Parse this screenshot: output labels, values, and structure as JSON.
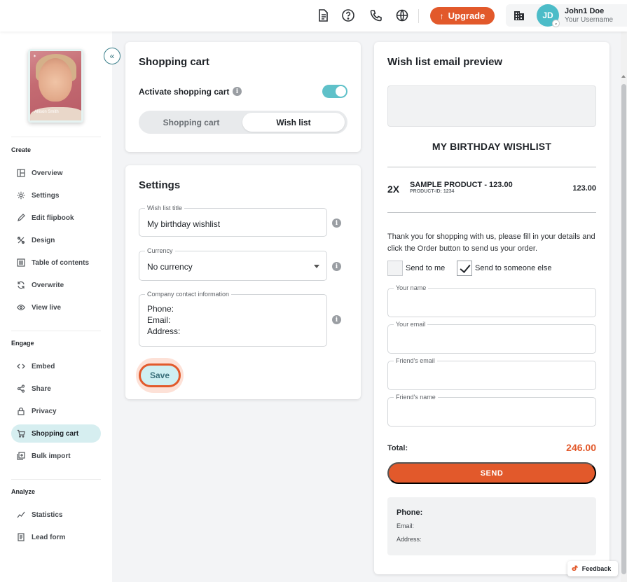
{
  "header": {
    "upgrade_label": "Upgrade",
    "user_name": "John1 Doe",
    "user_sub": "Your Username",
    "avatar_initials": "JD",
    "accent_color": "#e2592b"
  },
  "sidebar": {
    "thumb_text": "Allison Smith",
    "sections": {
      "create": "Create",
      "engage": "Engage",
      "analyze": "Analyze"
    },
    "create_items": [
      {
        "label": "Overview",
        "icon": "layout-icon"
      },
      {
        "label": "Settings",
        "icon": "gear-icon"
      },
      {
        "label": "Edit flipbook",
        "icon": "pencil-icon"
      },
      {
        "label": "Design",
        "icon": "design-tools-icon"
      },
      {
        "label": "Table of contents",
        "icon": "list-icon"
      },
      {
        "label": "Overwrite",
        "icon": "refresh-icon"
      },
      {
        "label": "View live",
        "icon": "eye-icon"
      }
    ],
    "engage_items": [
      {
        "label": "Embed",
        "icon": "code-icon"
      },
      {
        "label": "Share",
        "icon": "share-icon"
      },
      {
        "label": "Privacy",
        "icon": "lock-icon"
      },
      {
        "label": "Shopping cart",
        "icon": "cart-icon",
        "active": true
      },
      {
        "label": "Bulk import",
        "icon": "import-icon"
      }
    ],
    "analyze_items": [
      {
        "label": "Statistics",
        "icon": "chart-line-icon"
      },
      {
        "label": "Lead form",
        "icon": "form-icon"
      }
    ]
  },
  "cart_card": {
    "title": "Shopping cart",
    "activate_label": "Activate shopping cart",
    "toggle_on": true,
    "options": [
      "Shopping cart",
      "Wish list"
    ],
    "selected": "Wish list"
  },
  "settings_card": {
    "title": "Settings",
    "wishlist_title_label": "Wish list title",
    "wishlist_title_value": "My birthday wishlist",
    "currency_label": "Currency",
    "currency_value": "No currency",
    "contact_label": "Company contact information",
    "contact_value": "Phone:\nEmail:\nAddress:",
    "save_label": "Save"
  },
  "preview": {
    "title": "Wish list email preview",
    "heading": "MY BIRTHDAY WISHLIST",
    "item_qty": "2X",
    "item_name": "SAMPLE PRODUCT -  123.00",
    "item_id": "PRODUCT-ID: 1234",
    "item_price": "123.00",
    "thanks_text": "Thank you for shopping with us, please fill in your details and click the Order button to send us your order.",
    "send_to_me": "Send to me",
    "send_to_someone": "Send to someone else",
    "send_to_someone_checked": true,
    "fields": [
      "Your name",
      "Your email",
      "Friend's email",
      "Friend's name"
    ],
    "total_label": "Total:",
    "total_value": "246.00",
    "send_label": "SEND",
    "contact_phone": "Phone:",
    "contact_email": "Email:",
    "contact_address": "Address:"
  },
  "feedback_label": "Feedback"
}
